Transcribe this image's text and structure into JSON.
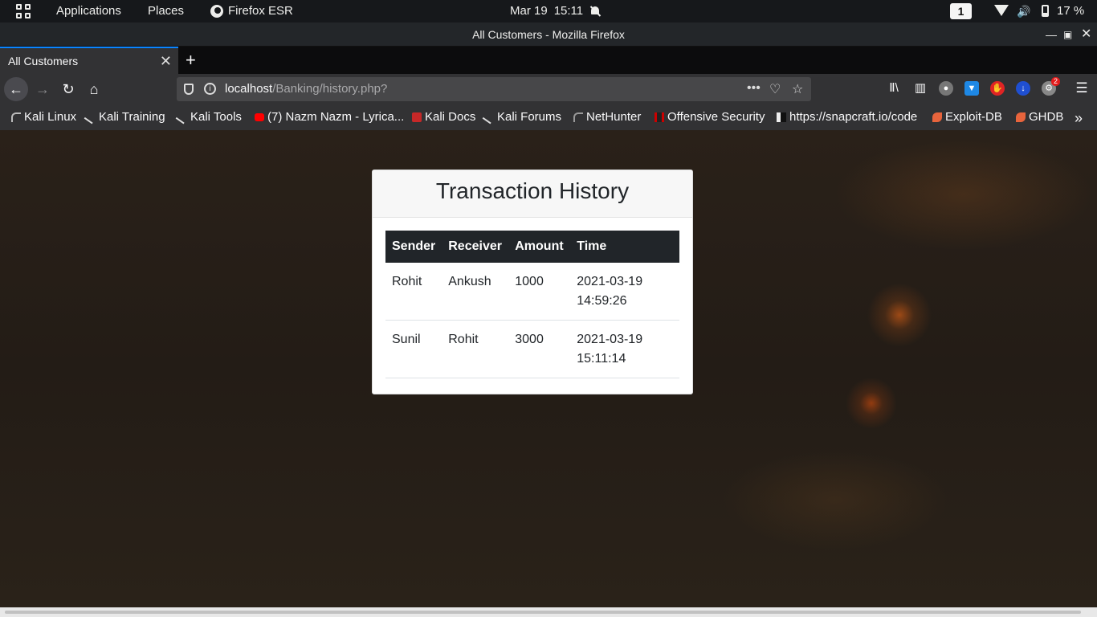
{
  "topbar": {
    "applications": "Applications",
    "places": "Places",
    "firefox": "Firefox ESR",
    "date": "Mar 19",
    "time": "15:11",
    "workspace": "1",
    "battery": "17 %"
  },
  "window": {
    "title": "All Customers - Mozilla Firefox"
  },
  "tabs": [
    {
      "label": "All Customers"
    }
  ],
  "url": {
    "host": "localhost",
    "path": "/Banking/history.php?"
  },
  "bookmarks": [
    {
      "label": "Kali Linux",
      "icon": "kali-dragon-icon"
    },
    {
      "label": "Kali Training",
      "icon": "kali-blade-icon"
    },
    {
      "label": "Kali Tools",
      "icon": "kali-blade-icon"
    },
    {
      "label": "(7) Nazm Nazm - Lyrica...",
      "icon": "youtube-icon"
    },
    {
      "label": "Kali Docs",
      "icon": "kali-docs-icon"
    },
    {
      "label": "Kali Forums",
      "icon": "kali-blade-icon"
    },
    {
      "label": "NetHunter",
      "icon": "nethunter-icon"
    },
    {
      "label": "Offensive Security",
      "icon": "offsec-icon"
    },
    {
      "label": "https://snapcraft.io/code",
      "icon": "snapcraft-icon"
    },
    {
      "label": "Exploit-DB",
      "icon": "exploit-db-icon"
    },
    {
      "label": "GHDB",
      "icon": "ghdb-icon"
    }
  ],
  "page": {
    "title": "Transaction History",
    "columns": [
      "Sender",
      "Receiver",
      "Amount",
      "Time"
    ],
    "rows": [
      {
        "sender": "Rohit",
        "receiver": "Ankush",
        "amount": "1000",
        "date": "2021-03-19",
        "time": "14:59:26"
      },
      {
        "sender": "Sunil",
        "receiver": "Rohit",
        "amount": "3000",
        "date": "2021-03-19",
        "time": "15:11:14"
      }
    ]
  },
  "toolbar": {
    "notification_count": "2"
  },
  "colors": {
    "accent": "#0a84ff",
    "table_header": "#212529"
  }
}
